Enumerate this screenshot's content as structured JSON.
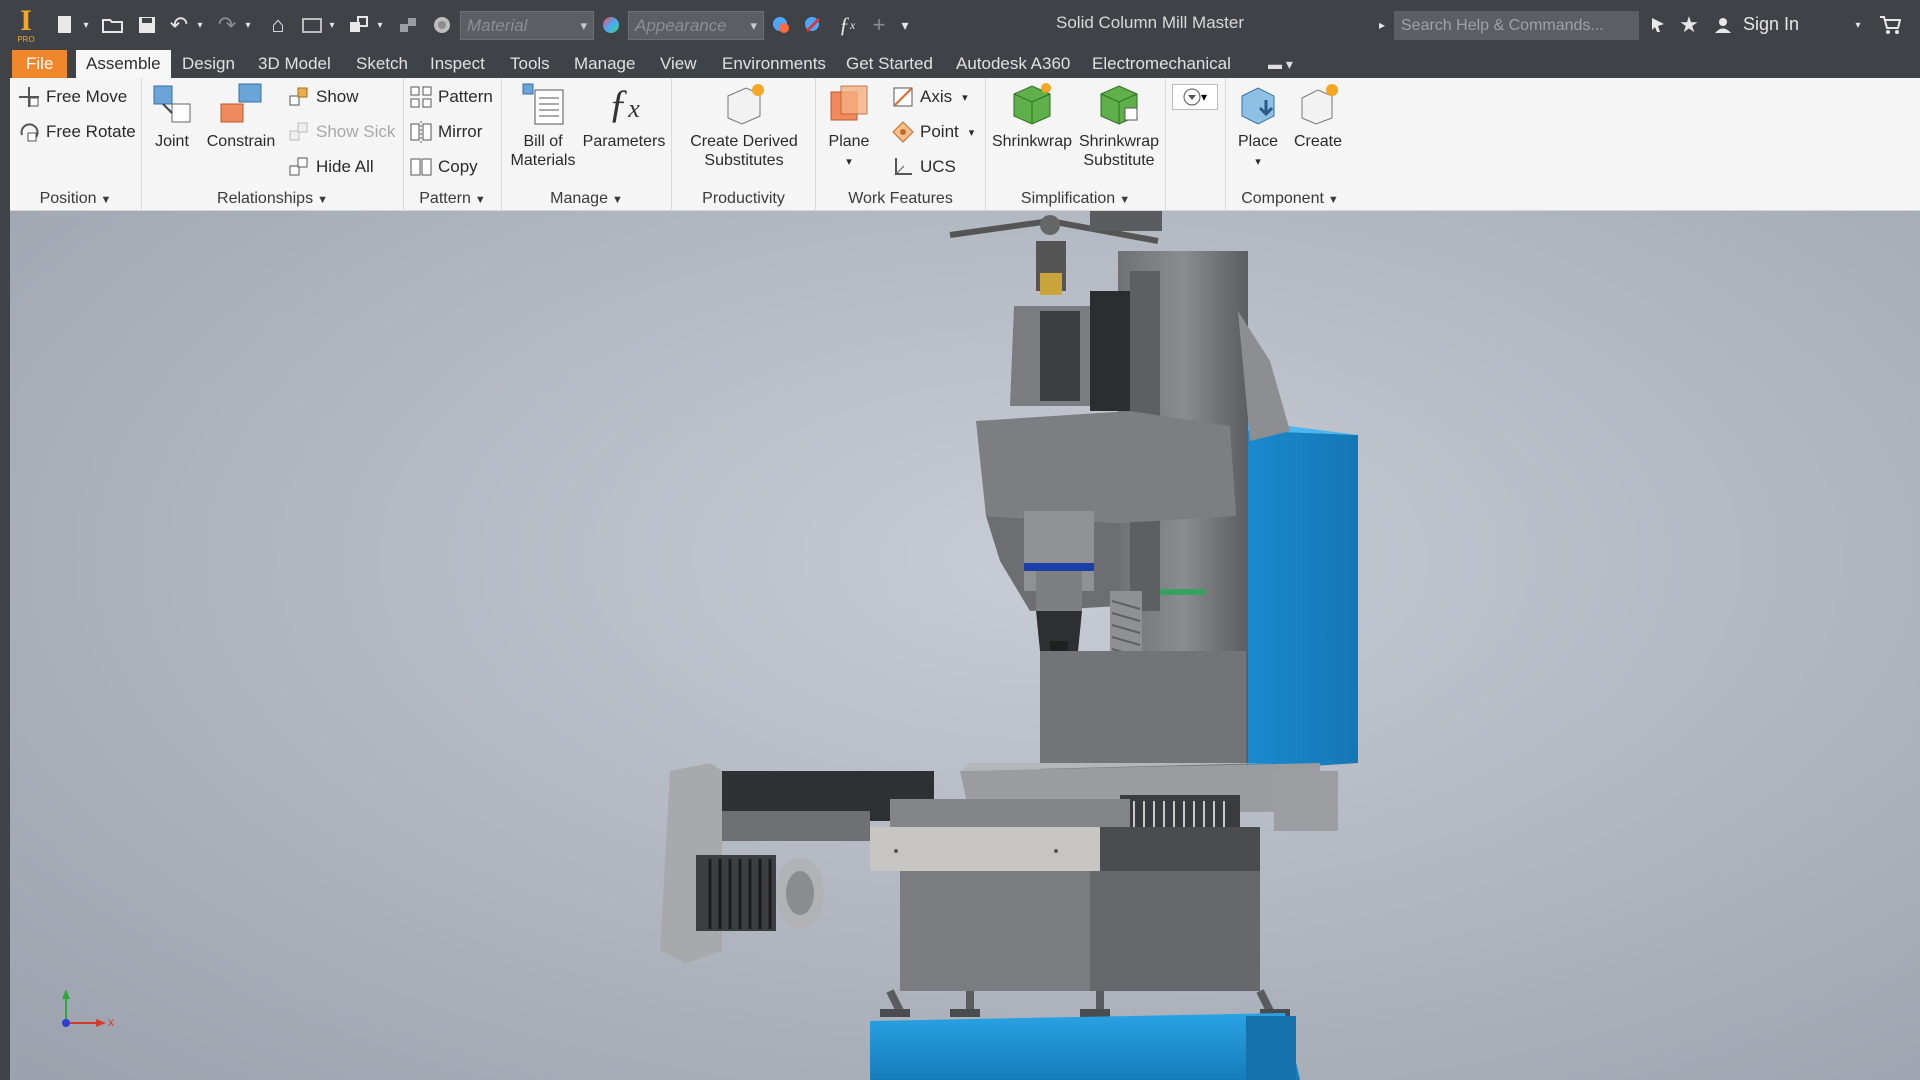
{
  "app": {
    "title": "Solid Column Mill Master",
    "logo_text": "I",
    "logo_sub": "PRO"
  },
  "quick_access": {
    "material_placeholder": "Material",
    "appearance_placeholder": "Appearance",
    "search_placeholder": "Search Help & Commands...",
    "sign_in": "Sign In"
  },
  "tabs": [
    {
      "label": "File"
    },
    {
      "label": "Assemble"
    },
    {
      "label": "Design"
    },
    {
      "label": "3D Model"
    },
    {
      "label": "Sketch"
    },
    {
      "label": "Inspect"
    },
    {
      "label": "Tools"
    },
    {
      "label": "Manage"
    },
    {
      "label": "View"
    },
    {
      "label": "Environments"
    },
    {
      "label": "Get Started"
    },
    {
      "label": "Autodesk A360"
    },
    {
      "label": "Electromechanical"
    }
  ],
  "ribbon": {
    "position": {
      "label": "Position",
      "free_move": "Free Move",
      "free_rotate": "Free Rotate"
    },
    "relationships": {
      "label": "Relationships",
      "joint": "Joint",
      "constrain": "Constrain",
      "show": "Show",
      "show_sick": "Show Sick",
      "hide_all": "Hide All"
    },
    "pattern": {
      "label": "Pattern",
      "pattern": "Pattern",
      "mirror": "Mirror",
      "copy": "Copy"
    },
    "manage": {
      "label": "Manage",
      "bom_line1": "Bill of",
      "bom_line2": "Materials",
      "parameters": "Parameters"
    },
    "productivity": {
      "label": "Productivity",
      "derived_line1": "Create Derived",
      "derived_line2": "Substitutes"
    },
    "work_features": {
      "label": "Work Features",
      "plane": "Plane",
      "axis": "Axis",
      "point": "Point",
      "ucs": "UCS"
    },
    "simplification": {
      "label": "Simplification",
      "shrinkwrap": "Shrinkwrap",
      "shrinkwrap_sub_line1": "Shrinkwrap",
      "shrinkwrap_sub_line2": "Substitute"
    },
    "component": {
      "label": "Component",
      "place": "Place",
      "create": "Create"
    }
  },
  "viewport": {
    "triad_x": "x"
  },
  "colors": {
    "accent_orange": "#f0872a",
    "titlebar": "#3f4348",
    "machine_blue": "#1e96d8"
  }
}
